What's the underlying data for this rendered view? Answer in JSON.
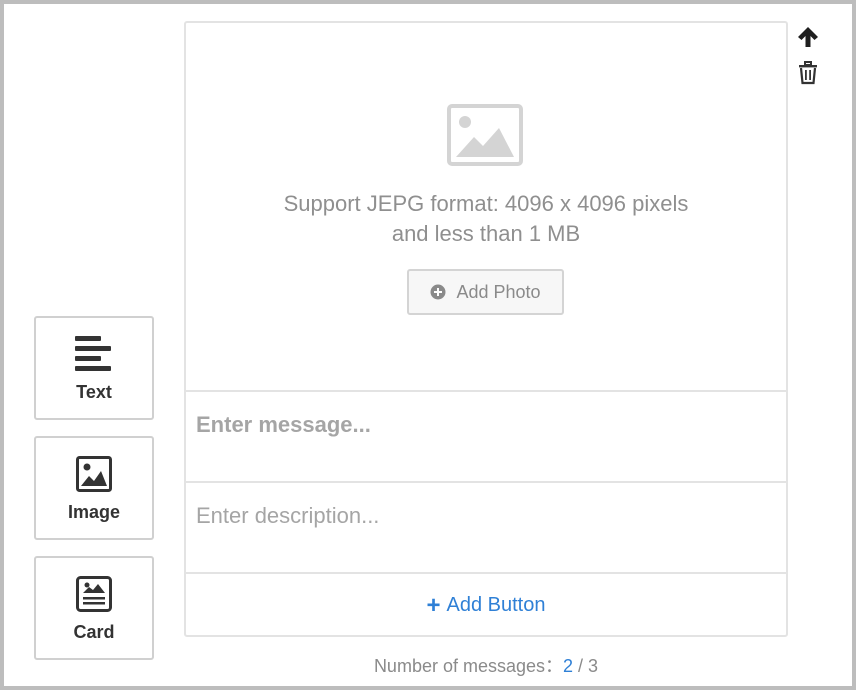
{
  "type_selector": {
    "items": [
      {
        "label": "Text",
        "icon": "align-left-icon"
      },
      {
        "label": "Image",
        "icon": "image-icon"
      },
      {
        "label": "Card",
        "icon": "card-icon"
      }
    ]
  },
  "card": {
    "photo_icon": "image-placeholder-icon",
    "hint_line1": "Support JEPG format: 4096 x 4096 pixels",
    "hint_line2": "and less than 1 MB",
    "add_photo_label": "Add Photo",
    "message_placeholder": "Enter message...",
    "description_placeholder": "Enter description...",
    "add_button_label": "Add Button"
  },
  "actions": {
    "move_up_icon": "arrow-up-icon",
    "delete_icon": "trash-icon"
  },
  "counter": {
    "label": "Number of messages：",
    "current": "2",
    "separator": " / ",
    "total": "3"
  },
  "colors": {
    "accent": "#2f80d6",
    "border": "#e3e3e3",
    "muted_text": "#8f8f8f"
  }
}
